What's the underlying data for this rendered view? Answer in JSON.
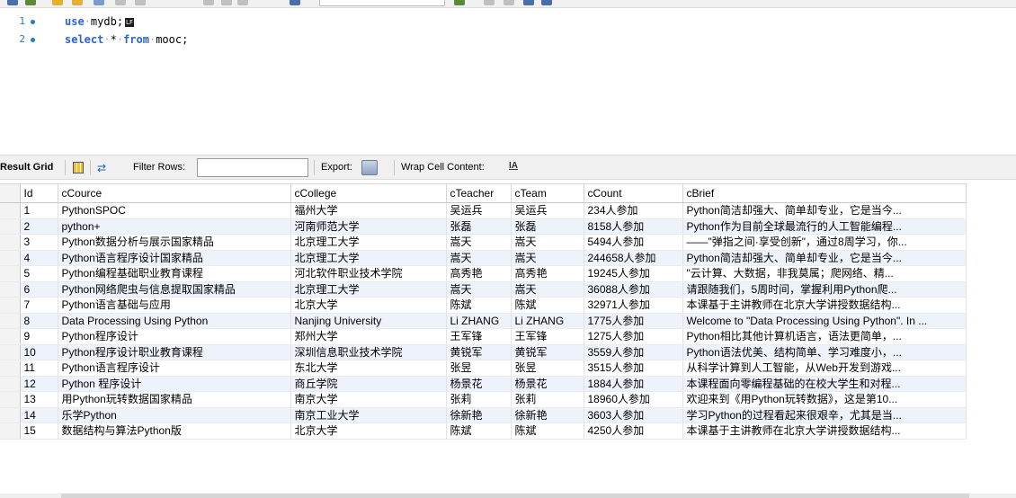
{
  "editor": {
    "lines": [
      {
        "num": "1",
        "keyword": "use",
        "rest": "mydb;",
        "eol": "LF"
      },
      {
        "num": "2",
        "keyword": "select",
        "star": "*",
        "keyword2": "from",
        "rest": "mooc;"
      }
    ]
  },
  "result_toolbar": {
    "result_grid_label": "Result Grid",
    "filter_label": "Filter Rows:",
    "filter_value": "",
    "export_label": "Export:",
    "wrap_label": "Wrap Cell Content:",
    "wrap_icon_text": "IA"
  },
  "grid": {
    "columns": [
      "Id",
      "cCource",
      "cCollege",
      "cTeacher",
      "cTeam",
      "cCount",
      "cBrief"
    ],
    "rows": [
      [
        "1",
        "PythonSPOC",
        "福州大学",
        "吴运兵",
        "吴运兵",
        "234人参加",
        "Python简洁却强大、简单却专业，它是当今..."
      ],
      [
        "2",
        "python+",
        "河南师范大学",
        "张磊",
        "张磊",
        "8158人参加",
        "Python作为目前全球最流行的人工智能编程..."
      ],
      [
        "3",
        "Python数据分析与展示国家精品",
        "北京理工大学",
        "嵩天",
        "嵩天",
        "5494人参加",
        "——\"弹指之间·享受创新\"，通过8周学习，你..."
      ],
      [
        "4",
        "Python语言程序设计国家精品",
        "北京理工大学",
        "嵩天",
        "嵩天",
        "244658人参加",
        "Python简洁却强大、简单却专业，它是当今..."
      ],
      [
        "5",
        "Python编程基础职业教育课程",
        "河北软件职业技术学院",
        "高秀艳",
        "高秀艳",
        "19245人参加",
        "\"云计算、大数据，非我莫属；爬网络、精..."
      ],
      [
        "6",
        "Python网络爬虫与信息提取国家精品",
        "北京理工大学",
        "嵩天",
        "嵩天",
        "36088人参加",
        "请跟随我们，5周时间，掌握利用Python爬..."
      ],
      [
        "7",
        "Python语言基础与应用",
        "北京大学",
        "陈斌",
        "陈斌",
        "32971人参加",
        "本课基于主讲教师在北京大学讲授数据结构..."
      ],
      [
        "8",
        "Data Processing Using Python",
        "Nanjing University",
        "Li ZHANG",
        "Li ZHANG",
        "1775人参加",
        "Welcome to \"Data Processing Using Python\". In ..."
      ],
      [
        "9",
        "Python程序设计",
        "郑州大学",
        "王军锋",
        "王军锋",
        "1275人参加",
        "Python相比其他计算机语言，语法更简单，..."
      ],
      [
        "10",
        "Python程序设计职业教育课程",
        "深圳信息职业技术学院",
        "黄锐军",
        "黄锐军",
        "3559人参加",
        "Python语法优美、结构简单、学习难度小，..."
      ],
      [
        "11",
        "Python语言程序设计",
        "东北大学",
        "张昱",
        "张昱",
        "3515人参加",
        "从科学计算到人工智能，从Web开发到游戏..."
      ],
      [
        "12",
        "Python 程序设计",
        "商丘学院",
        "杨景花",
        "杨景花",
        "1884人参加",
        "本课程面向零编程基础的在校大学生和对程..."
      ],
      [
        "13",
        "用Python玩转数据国家精品",
        "南京大学",
        "张莉",
        "张莉",
        "18960人参加",
        "欢迎来到《用Python玩转数据》，这是第10..."
      ],
      [
        "14",
        "乐学Python",
        "南京工业大学",
        "徐新艳",
        "徐新艳",
        "3603人参加",
        "学习Python的过程看起来很艰辛，尤其是当..."
      ],
      [
        "15",
        "数据结构与算法Python版",
        "北京大学",
        "陈斌",
        "陈斌",
        "4250人参加",
        "本课基于主讲教师在北京大学讲授数据结构..."
      ]
    ]
  },
  "colors": {
    "keyword": "#2b64d6",
    "line_number": "#2b7bb9",
    "alt_row": "#eef3fb"
  }
}
